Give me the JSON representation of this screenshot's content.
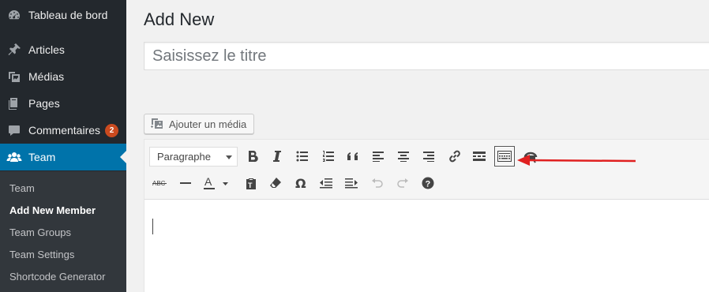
{
  "sidebar": {
    "items": [
      {
        "label": "Tableau de bord",
        "icon": "dashboard-icon"
      },
      {
        "label": "Articles",
        "icon": "pin-icon"
      },
      {
        "label": "Médias",
        "icon": "media-icon"
      },
      {
        "label": "Pages",
        "icon": "pages-icon"
      },
      {
        "label": "Commentaires",
        "icon": "comment-icon",
        "badge": "2"
      },
      {
        "label": "Team",
        "icon": "team-icon",
        "active": true
      }
    ],
    "submenu": [
      {
        "label": "Team"
      },
      {
        "label": "Add New Member",
        "current": true
      },
      {
        "label": "Team Groups"
      },
      {
        "label": "Team Settings"
      },
      {
        "label": "Shortcode Generator"
      }
    ]
  },
  "main": {
    "title": "Add New",
    "title_input": {
      "placeholder": "Saisissez le titre",
      "value": ""
    },
    "add_media_label": "Ajouter un média"
  },
  "editor": {
    "format_select": "Paragraphe",
    "toolbar_row1": [
      "bold-icon",
      "italic-icon",
      "bullet-list-icon",
      "numbered-list-icon",
      "blockquote-icon",
      "align-left-icon",
      "align-center-icon",
      "align-right-icon",
      "link-icon",
      "read-more-icon",
      "toolbar-toggle-icon",
      "vcard-icon"
    ],
    "toolbar_row2": [
      "strikethrough-icon",
      "horizontal-line-icon",
      "text-color-icon",
      "paste-text-icon",
      "clear-formatting-icon",
      "special-character-icon",
      "outdent-icon",
      "indent-icon",
      "undo-icon",
      "redo-icon",
      "help-icon"
    ]
  },
  "colors": {
    "sidebar_bg": "#23282d",
    "active_bg": "#0073aa",
    "badge_bg": "#ca4a1f",
    "annotation_arrow": "#e02020"
  }
}
